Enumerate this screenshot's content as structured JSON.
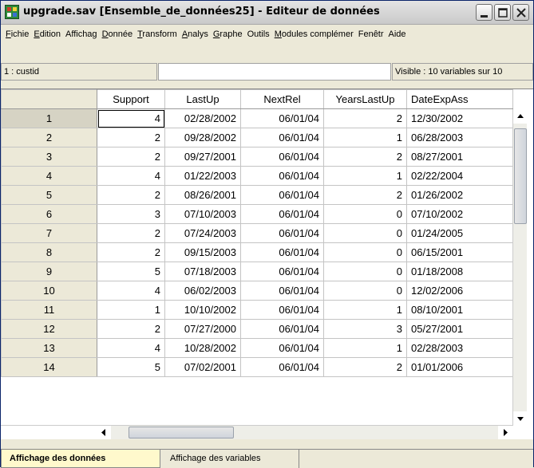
{
  "window": {
    "title": "upgrade.sav [Ensemble_de_données25] - Editeur de données"
  },
  "menu": {
    "items": [
      {
        "u": "F",
        "rest": "ichie"
      },
      {
        "u": "E",
        "rest": "dition"
      },
      {
        "u": "",
        "rest": "Affichag"
      },
      {
        "u": "D",
        "rest": "onnée"
      },
      {
        "u": "T",
        "rest": "ransform"
      },
      {
        "u": "A",
        "rest": "nalys"
      },
      {
        "u": "G",
        "rest": "raphe"
      },
      {
        "u": "",
        "rest": "Outils"
      },
      {
        "u": "M",
        "rest": "odules complémer"
      },
      {
        "u": "",
        "rest": "Fenêtr"
      },
      {
        "u": "",
        "rest": "Aide"
      }
    ]
  },
  "editor": {
    "cell_ref": "1 : custid",
    "cell_value": "",
    "visible_info": "Visible : 10 variables sur 10"
  },
  "grid": {
    "columns": [
      "Support",
      "LastUp",
      "NextRel",
      "YearsLastUp",
      "DateExpAss"
    ],
    "rows": [
      {
        "n": "1",
        "cells": [
          "4",
          "02/28/2002",
          "06/01/04",
          "2",
          "12/30/2002"
        ]
      },
      {
        "n": "2",
        "cells": [
          "2",
          "09/28/2002",
          "06/01/04",
          "1",
          "06/28/2003"
        ]
      },
      {
        "n": "3",
        "cells": [
          "2",
          "09/27/2001",
          "06/01/04",
          "2",
          "08/27/2001"
        ]
      },
      {
        "n": "4",
        "cells": [
          "4",
          "01/22/2003",
          "06/01/04",
          "1",
          "02/22/2004"
        ]
      },
      {
        "n": "5",
        "cells": [
          "2",
          "08/26/2001",
          "06/01/04",
          "2",
          "01/26/2002"
        ]
      },
      {
        "n": "6",
        "cells": [
          "3",
          "07/10/2003",
          "06/01/04",
          "0",
          "07/10/2002"
        ]
      },
      {
        "n": "7",
        "cells": [
          "2",
          "07/24/2003",
          "06/01/04",
          "0",
          "01/24/2005"
        ]
      },
      {
        "n": "8",
        "cells": [
          "2",
          "09/15/2003",
          "06/01/04",
          "0",
          "06/15/2001"
        ]
      },
      {
        "n": "9",
        "cells": [
          "5",
          "07/18/2003",
          "06/01/04",
          "0",
          "01/18/2008"
        ]
      },
      {
        "n": "10",
        "cells": [
          "4",
          "06/02/2003",
          "06/01/04",
          "0",
          "12/02/2006"
        ]
      },
      {
        "n": "11",
        "cells": [
          "1",
          "10/10/2002",
          "06/01/04",
          "1",
          "08/10/2001"
        ]
      },
      {
        "n": "12",
        "cells": [
          "2",
          "07/27/2000",
          "06/01/04",
          "3",
          "05/27/2001"
        ]
      },
      {
        "n": "13",
        "cells": [
          "4",
          "10/28/2002",
          "06/01/04",
          "1",
          "02/28/2003"
        ]
      },
      {
        "n": "14",
        "cells": [
          "5",
          "07/02/2001",
          "06/01/04",
          "2",
          "01/01/2006"
        ]
      }
    ]
  },
  "tabs": {
    "data_view": "Affichage des données",
    "variable_view": "Affichage des variables"
  },
  "colors": {
    "active_tab": "#fff9cc",
    "chrome": "#ece9d8"
  }
}
